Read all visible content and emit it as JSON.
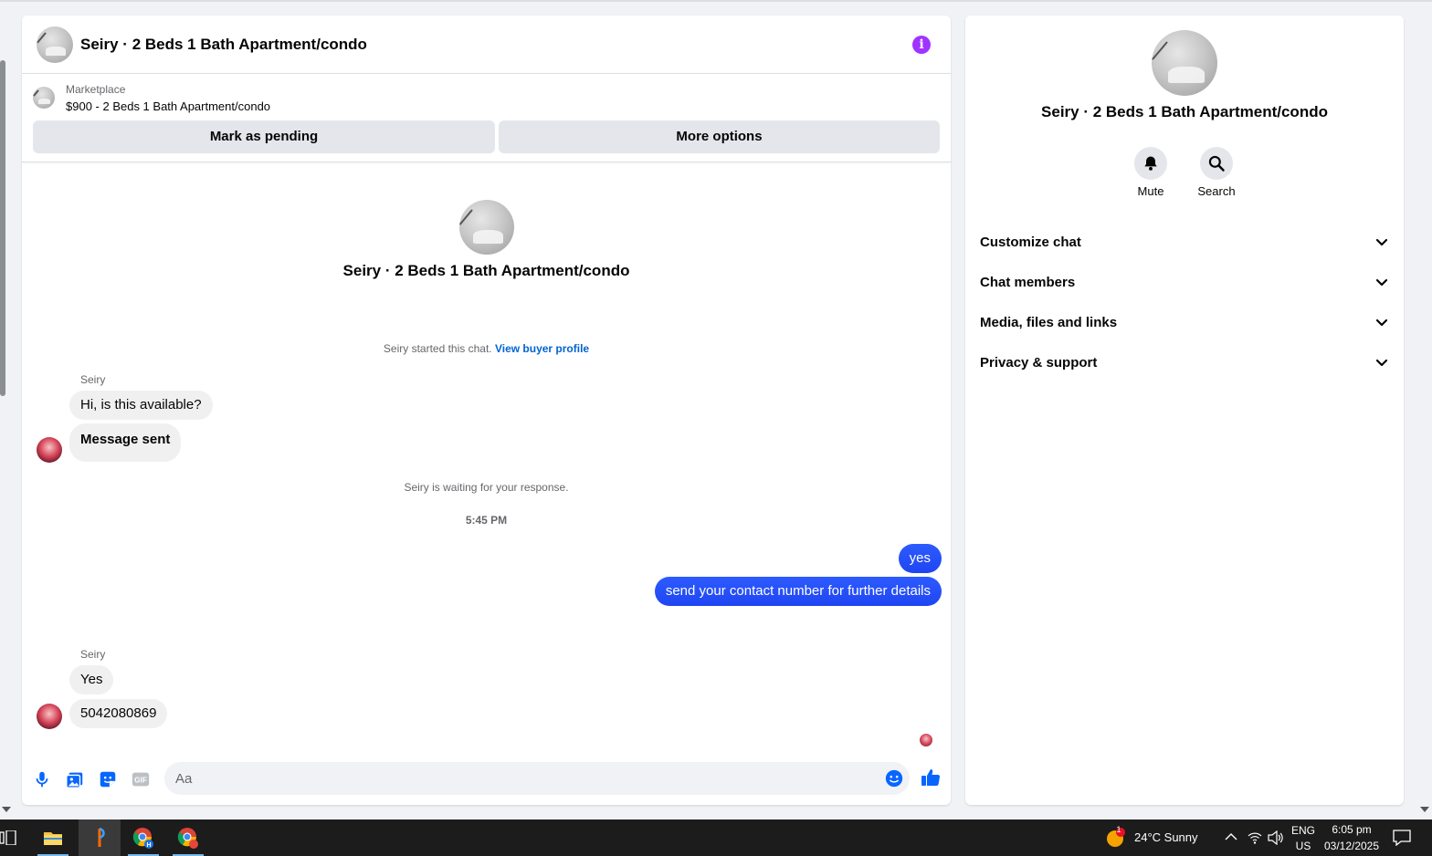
{
  "chat": {
    "title": "Seiry · 2 Beds 1 Bath Apartment/condo",
    "marketplace_label": "Marketplace",
    "listing": "$900 - 2 Beds 1 Bath Apartment/condo",
    "mark_pending_label": "Mark as pending",
    "more_options_label": "More options",
    "started_text": "Seiry started this chat.",
    "view_profile_link": "View buyer profile",
    "waiting_text": "Seiry is waiting for your response.",
    "timestamp": "5:45 PM",
    "groups": [
      {
        "sender": "Seiry",
        "messages": [
          "Hi, is this available?",
          "Message sent"
        ]
      },
      {
        "sender": "Seiry",
        "messages": [
          "Yes",
          "5042080869"
        ]
      }
    ],
    "outgoing": [
      "yes",
      "send your contact number for further details"
    ],
    "composer_placeholder": "Aa"
  },
  "info_panel": {
    "title": "Seiry · 2 Beds 1 Bath Apartment/condo",
    "mute_label": "Mute",
    "search_label": "Search",
    "sections": [
      "Customize chat",
      "Chat members",
      "Media, files and links",
      "Privacy & support"
    ]
  },
  "taskbar": {
    "weather_badge": "1",
    "weather": "24°C  Sunny",
    "lang_top": "ENG",
    "lang_bottom": "US",
    "time": "6:05 pm",
    "date": "03/12/2025"
  },
  "colors": {
    "accent": "#0866ff",
    "outgoing_bubble": "#1f45f2",
    "info_icon": "#a033ff"
  }
}
